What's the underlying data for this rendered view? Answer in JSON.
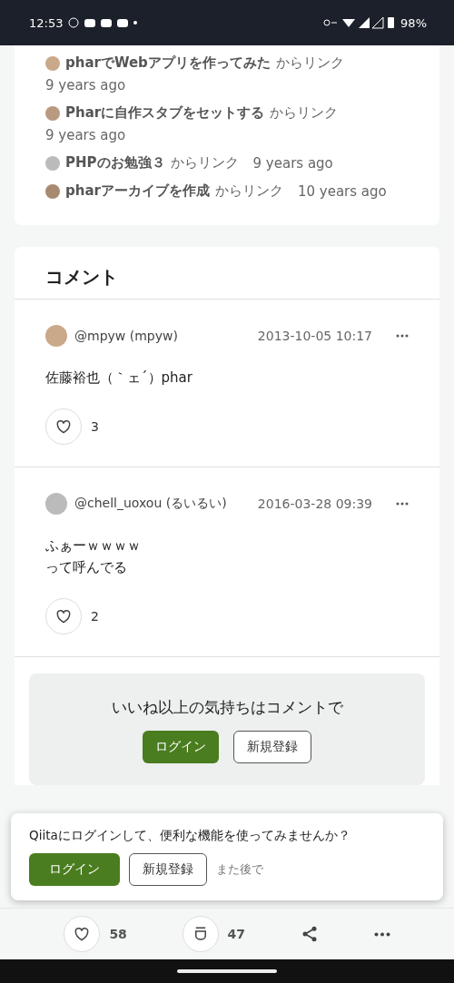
{
  "status_bar": {
    "time": "12:53",
    "battery": "98%"
  },
  "linked_from": [
    {
      "title": "pharでWebアプリを作ってみた",
      "suffix": "からリンク",
      "time": "9 years ago"
    },
    {
      "title": "Pharに自作スタブをセットする",
      "suffix": "からリンク",
      "time": "9 years ago"
    },
    {
      "title": "PHPのお勉強３",
      "suffix": "からリンク",
      "time": "9 years ago"
    },
    {
      "title": "pharアーカイブを作成",
      "suffix": "からリンク",
      "time": "10 years ago"
    }
  ],
  "comments": {
    "heading": "コメント",
    "items": [
      {
        "user": "@mpyw (mpyw)",
        "date": "2013-10-05 10:17",
        "body": [
          "佐藤裕也（｀ェ´）phar"
        ],
        "likes": "3"
      },
      {
        "user": "@chell_uoxou (るいるい)",
        "date": "2016-03-28 09:39",
        "body": [
          "ふぁーｗｗｗｗ",
          "って呼んでる"
        ],
        "likes": "2"
      }
    ]
  },
  "comment_cta": {
    "text": "いいね以上の気持ちはコメントで",
    "login": "ログイン",
    "signup": "新規登録"
  },
  "login_sheet": {
    "message": "Qiitaにログインして、便利な機能を使ってみませんか？",
    "login": "ログイン",
    "signup": "新規登録",
    "later": "また後で"
  },
  "action_bar": {
    "likes": "58",
    "stocks": "47"
  }
}
